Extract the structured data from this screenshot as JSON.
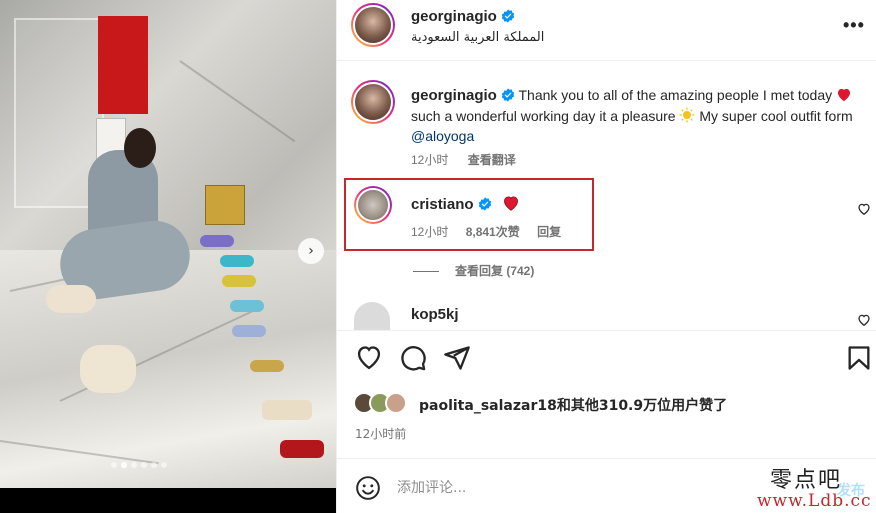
{
  "photo": {
    "carousel_dots": 6,
    "active_dot": 1,
    "next_button_glyph": "›"
  },
  "header": {
    "username": "georginagio",
    "location": "المملكة العربية السعودية",
    "more_glyph": "•••"
  },
  "caption": {
    "username": "georginagio",
    "text_1": "Thank you to all of the amazing people I met today",
    "text_2": "such a wonderful working day it a pleasure",
    "text_3": "My super cool outfit form",
    "mention": "@aloyoga",
    "time": "12小时",
    "translate": "查看翻译"
  },
  "comments": [
    {
      "username": "cristiano",
      "time": "12小时",
      "likes": "8,841次赞",
      "reply": "回复",
      "view_replies": "查看回复 (742)"
    },
    {
      "username": "kop5kj"
    }
  ],
  "likes": {
    "text": "paolita_salazar18和其他310.9万位用户赞了"
  },
  "post_time": "12小时前",
  "comment_box": {
    "placeholder": "添加评论...",
    "post_label": "发布"
  },
  "watermark": {
    "line1": "零点吧",
    "line2": "www.Ldb.cc"
  },
  "colors": {
    "verified": "#0095f6",
    "heart": "#e0182f",
    "highlight_box": "#c7282e",
    "link": "#00376b"
  }
}
